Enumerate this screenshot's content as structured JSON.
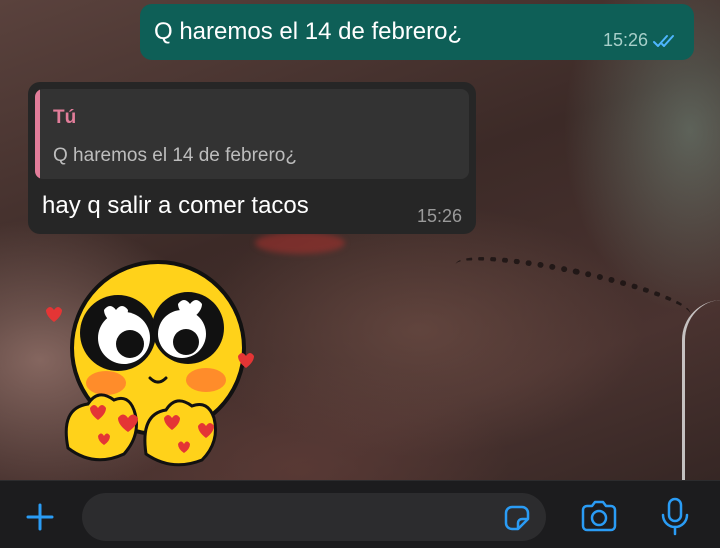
{
  "colors": {
    "accent": "#2a9cf5",
    "outgoing_bubble": "#0e5f57",
    "incoming_bubble": "#262626",
    "quote_accent": "#e27d9a"
  },
  "messages": {
    "outgoing": {
      "text": "Q haremos el 14 de febrero¿",
      "time": "15:26",
      "status_icon": "double-check-icon"
    },
    "incoming": {
      "quote_author": "Tú",
      "quote_text": "Q haremos el 14 de febrero¿",
      "text": "hay q salir a comer tacos",
      "time": "15:26"
    },
    "sticker": {
      "icon": "smiley-sticker"
    }
  },
  "composer": {
    "placeholder": "",
    "value": "",
    "icons": [
      "plus-icon",
      "sticker-icon",
      "camera-icon",
      "microphone-icon"
    ]
  }
}
